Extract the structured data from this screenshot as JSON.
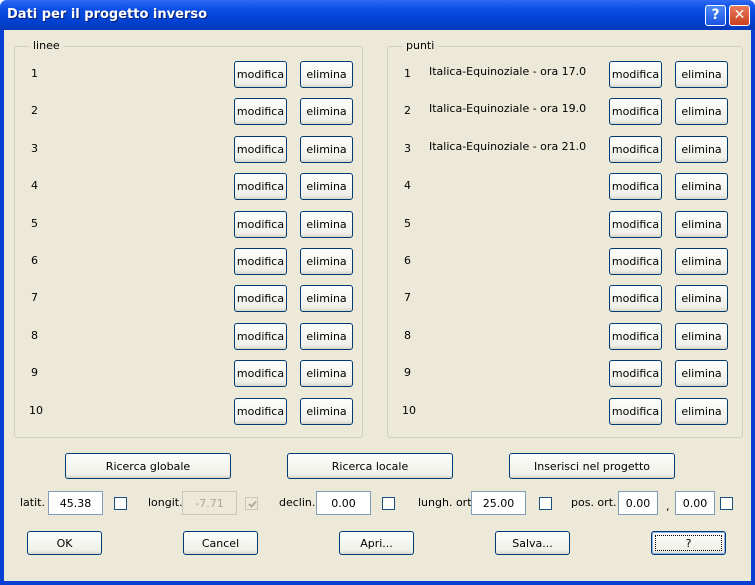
{
  "window": {
    "title": "Dati per il progetto inverso",
    "help_glyph": "?",
    "close_glyph": "✕"
  },
  "lines_group": {
    "legend": "linee",
    "rows": [
      {
        "num": "1",
        "name": ""
      },
      {
        "num": "2",
        "name": ""
      },
      {
        "num": "3",
        "name": ""
      },
      {
        "num": "4",
        "name": ""
      },
      {
        "num": "5",
        "name": ""
      },
      {
        "num": "6",
        "name": ""
      },
      {
        "num": "7",
        "name": ""
      },
      {
        "num": "8",
        "name": ""
      },
      {
        "num": "9",
        "name": ""
      },
      {
        "num": "10",
        "name": ""
      }
    ]
  },
  "points_group": {
    "legend": "punti",
    "rows": [
      {
        "num": "1",
        "name": "Italica-Equinoziale - ora 17.0"
      },
      {
        "num": "2",
        "name": "Italica-Equinoziale - ora 19.0"
      },
      {
        "num": "3",
        "name": "Italica-Equinoziale - ora 21.0"
      },
      {
        "num": "4",
        "name": ""
      },
      {
        "num": "5",
        "name": ""
      },
      {
        "num": "6",
        "name": ""
      },
      {
        "num": "7",
        "name": ""
      },
      {
        "num": "8",
        "name": ""
      },
      {
        "num": "9",
        "name": ""
      },
      {
        "num": "10",
        "name": ""
      }
    ]
  },
  "row_buttons": {
    "modify_label": "modifica",
    "delete_label": "elimina"
  },
  "search_buttons": {
    "global_label": "Ricerca globale",
    "local_label": "Ricerca locale",
    "insert_label": "Inserisci nel progetto"
  },
  "params": {
    "latit_label": "latit.",
    "latit_value": "45.38",
    "longit_label": "longit.",
    "longit_value": "-7.71",
    "declin_label": "declin.",
    "declin_value": "0.00",
    "lungh_label": "lungh. ort.",
    "lungh_value": "25.00",
    "pos_label": "pos. ort.",
    "pos_x_value": "0.00",
    "pos_sep": ",",
    "pos_y_value": "0.00"
  },
  "footer_buttons": {
    "ok_label": "OK",
    "cancel_label": "Cancel",
    "open_label": "Apri...",
    "save_label": "Salva...",
    "help_label": "?"
  }
}
